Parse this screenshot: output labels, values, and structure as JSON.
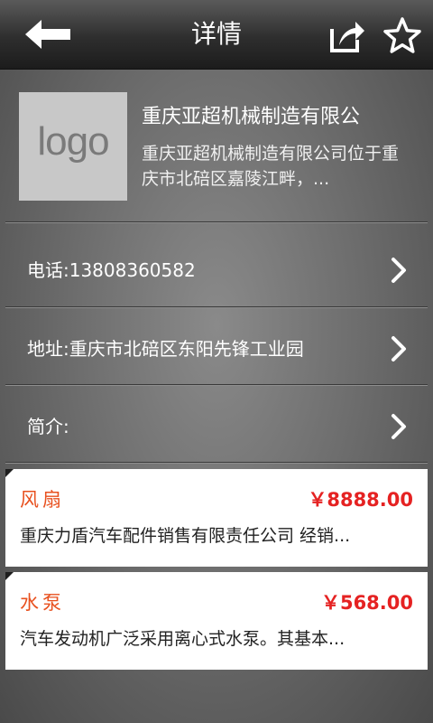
{
  "header": {
    "title": "详情",
    "back_icon": "arrow-left-icon",
    "share_icon": "share-icon",
    "favorite_icon": "star-icon"
  },
  "company": {
    "logo_text": "logo",
    "name": "重庆亚超机械制造有限公",
    "description": "重庆亚超机械制造有限公司位于重庆市北碚区嘉陵江畔，..."
  },
  "info": {
    "phone": "电话:13808360582",
    "address": "地址:重庆市北碚区东阳先锋工业园",
    "intro": "简介:"
  },
  "products": [
    {
      "name": "风扇",
      "price": "￥8888.00",
      "description": "重庆力盾汽车配件销售有限责任公司 经销..."
    },
    {
      "name": "水泵",
      "price": "￥568.00",
      "description": "汽车发动机广泛采用离心式水泵。其基本..."
    }
  ],
  "colors": {
    "product_name": "#e8501e",
    "price": "#e52222"
  }
}
